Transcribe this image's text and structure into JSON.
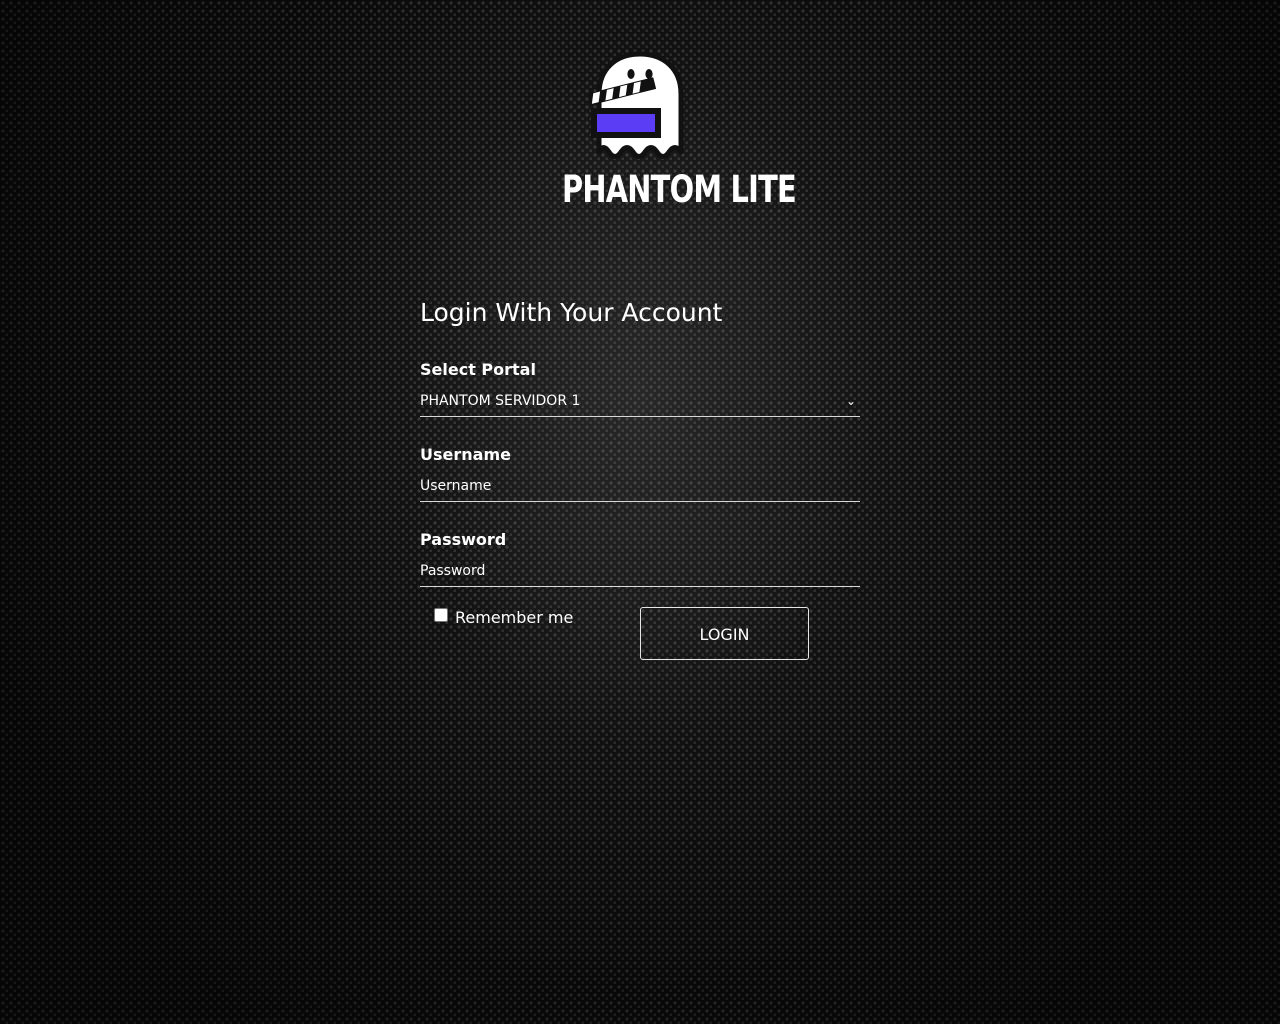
{
  "brand": {
    "name": "PHANTOM LITE",
    "logo_icon": "ghost-clapperboard-icon",
    "accent_color": "#5b3df5"
  },
  "form": {
    "heading": "Login With Your Account",
    "portal": {
      "label": "Select Portal",
      "selected_value": "PHANTOM SERVIDOR 1",
      "icon": "chevron-down-icon"
    },
    "username": {
      "label": "Username",
      "placeholder": "Username"
    },
    "password": {
      "label": "Password",
      "placeholder": "Password"
    },
    "remember": {
      "label": "Remember me",
      "checked": false
    },
    "submit_label": "LOGIN"
  }
}
